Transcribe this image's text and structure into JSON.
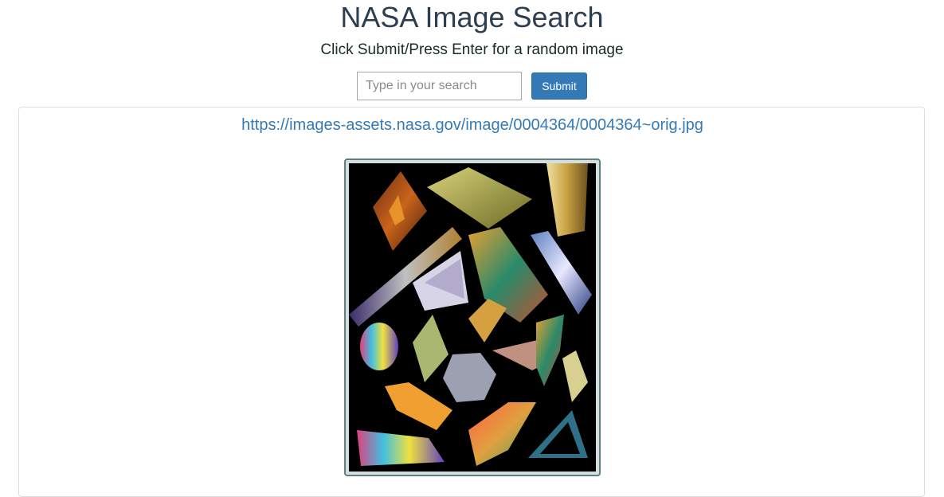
{
  "header": {
    "title": "NASA Image Search",
    "subtitle": "Click Submit/Press Enter for a random image"
  },
  "search": {
    "placeholder": "Type in your search",
    "value": "",
    "submit_label": "Submit"
  },
  "result": {
    "image_url": "https://images-assets.nasa.gov/image/0004364/0004364~orig.jpg"
  },
  "colors": {
    "title": "#2c3e50",
    "link": "#337ab7",
    "button": "#337ab7",
    "frame_border": "#5f7f80"
  }
}
